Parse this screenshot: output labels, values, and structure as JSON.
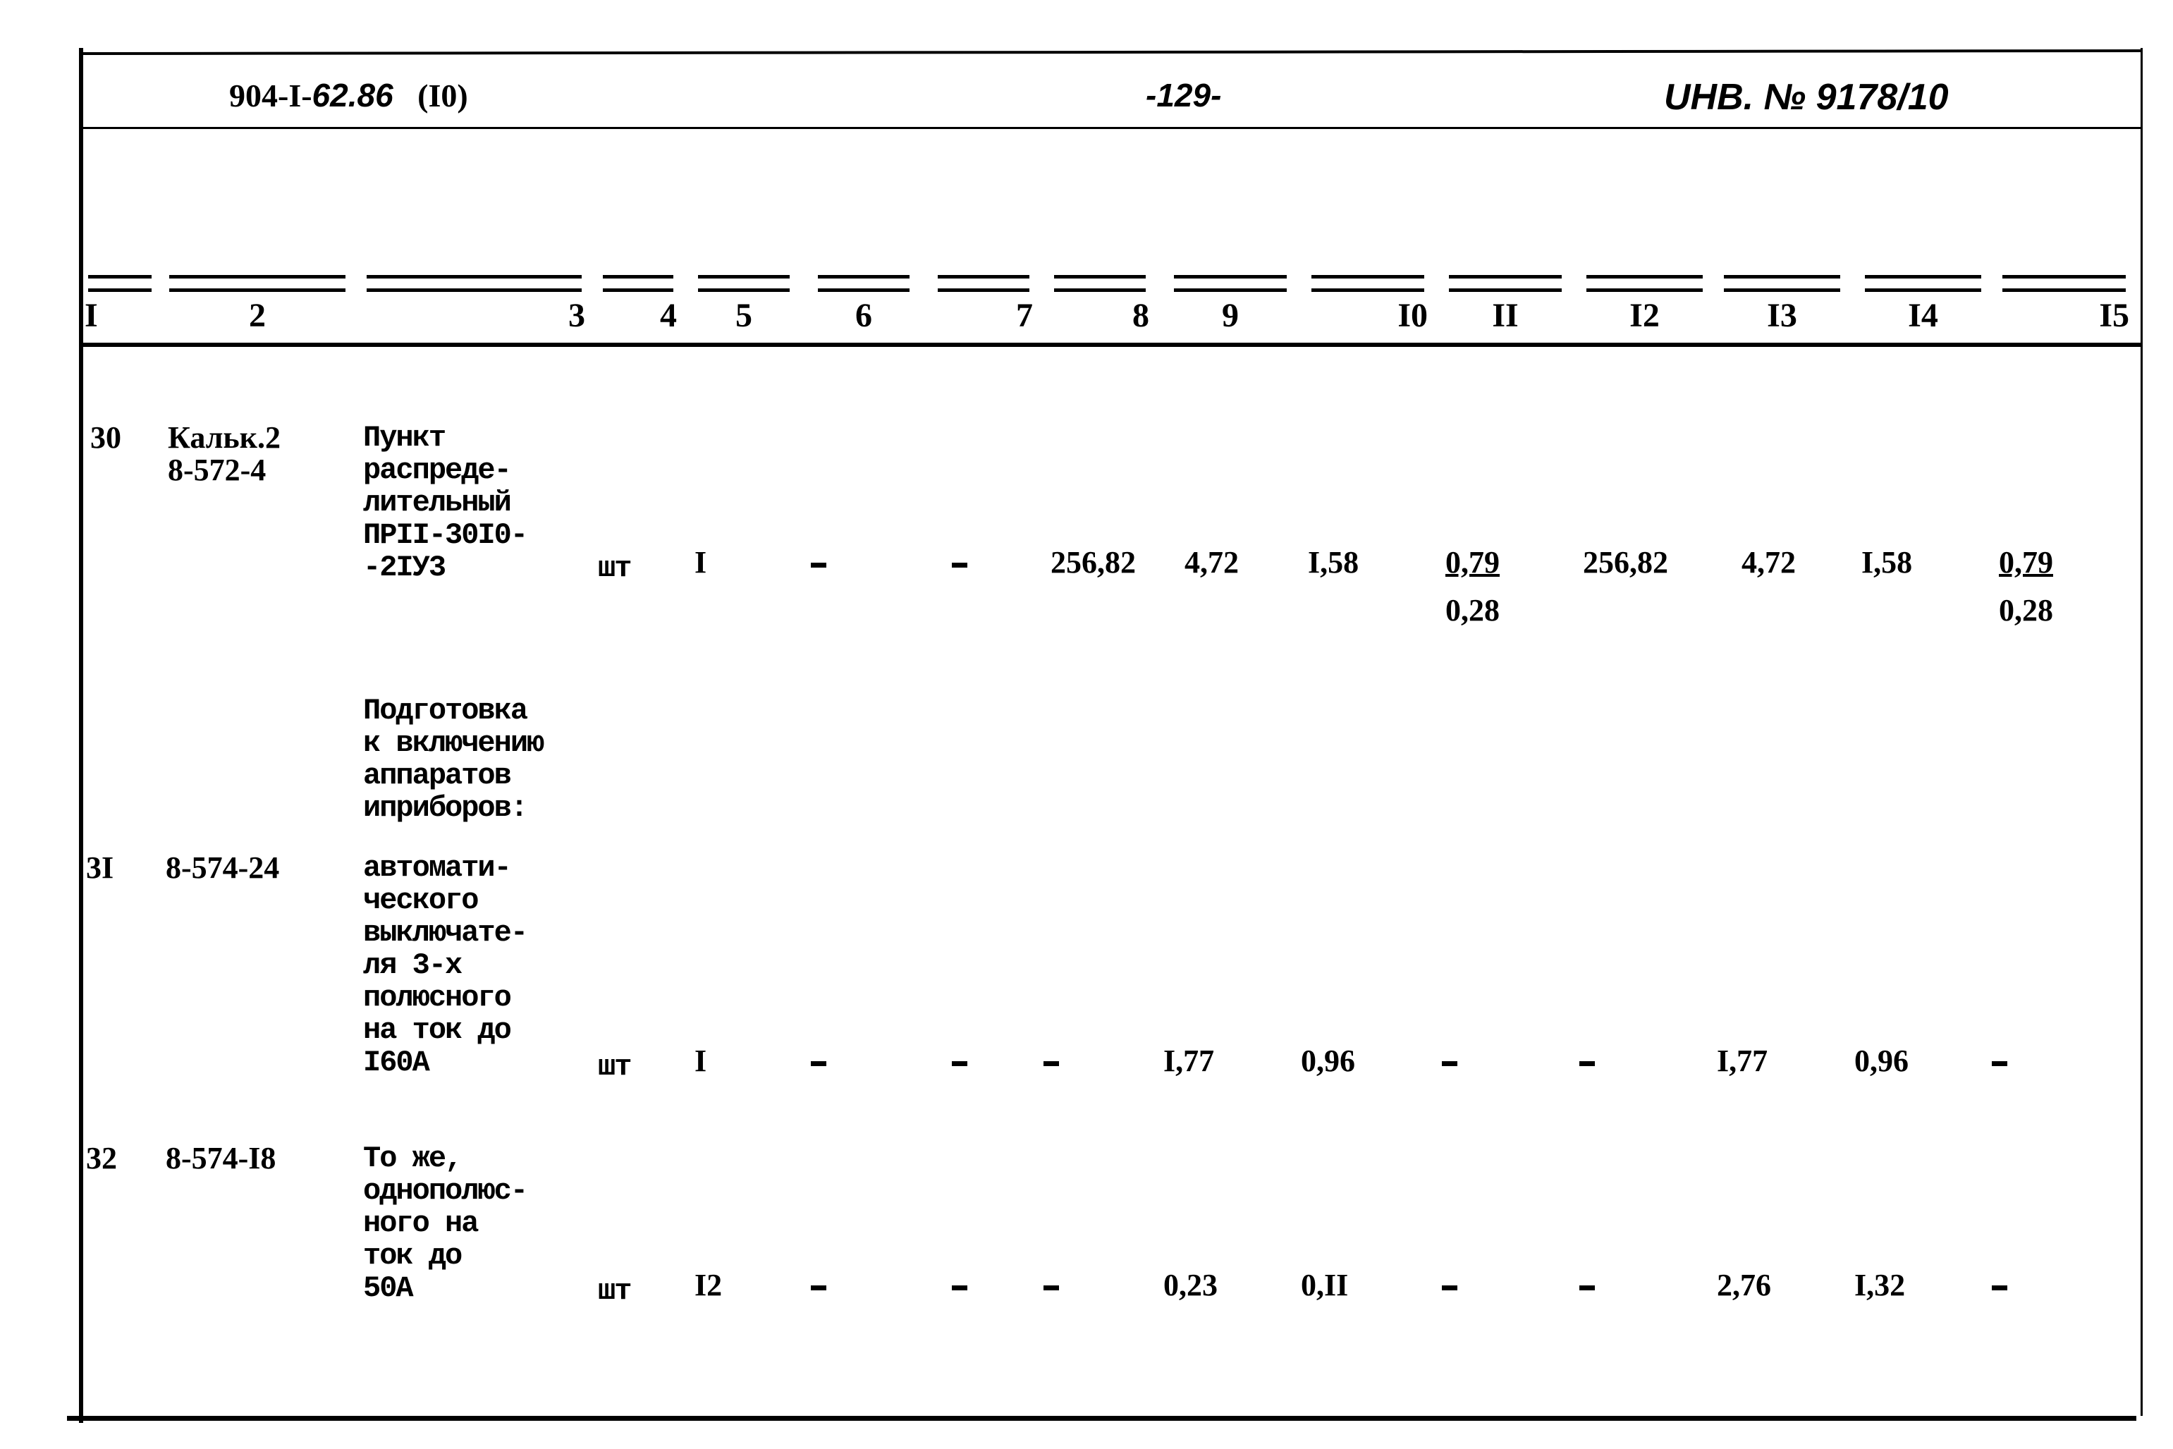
{
  "header": {
    "doc_code_prefix": "904-I-",
    "doc_code_suffix": "62.86",
    "sheet_ref": "(I0)",
    "page_number": "-129-",
    "inventory_ref": "UHB. № 9178/10"
  },
  "columns": [
    "I",
    "2",
    "3",
    "4",
    "5",
    "6",
    "7",
    "8",
    "9",
    "I0",
    "II",
    "I2",
    "I3",
    "I4",
    "I5"
  ],
  "rows": [
    {
      "num": "30",
      "code": [
        "Кальк.2",
        "8-572-4"
      ],
      "description": [
        "Пункт",
        "распреде-",
        "лительный",
        "ПРII-30I0-",
        "-2IУ3"
      ],
      "unit": "шт",
      "qty": "I",
      "c6": "-",
      "c7": "-",
      "c8": "256,82",
      "c9": "4,72",
      "c10": "I,58",
      "c11_top": "0,79",
      "c11_bottom": "0,28",
      "c12": "256,82",
      "c13": "4,72",
      "c14": "I,58",
      "c15_top": "0,79",
      "c15_bottom": "0,28"
    },
    {
      "section_title": [
        "Подготовка",
        "к включению",
        "аппаратов",
        "иприборов:"
      ]
    },
    {
      "num": "3I",
      "code": [
        "8-574-24"
      ],
      "description": [
        "автомати-",
        "ческого",
        "выключате-",
        "ля 3-х",
        "полюсного",
        "на ток до",
        "I60А"
      ],
      "unit": "шт",
      "qty": "I",
      "c6": "-",
      "c7": "-",
      "c8": "-",
      "c9": "I,77",
      "c10": "0,96",
      "c11": "-",
      "c12": "-",
      "c13": "I,77",
      "c14": "0,96",
      "c15": "-"
    },
    {
      "num": "32",
      "code": [
        "8-574-I8"
      ],
      "description": [
        "То же,",
        "однополюс-",
        "ного на",
        "ток до",
        "50А"
      ],
      "unit": "шт",
      "qty": "I2",
      "c6": "-",
      "c7": "-",
      "c8": "-",
      "c9": "0,23",
      "c10": "0,II",
      "c11": "-",
      "c12": "-",
      "c13": "2,76",
      "c14": "I,32",
      "c15": "-"
    }
  ]
}
